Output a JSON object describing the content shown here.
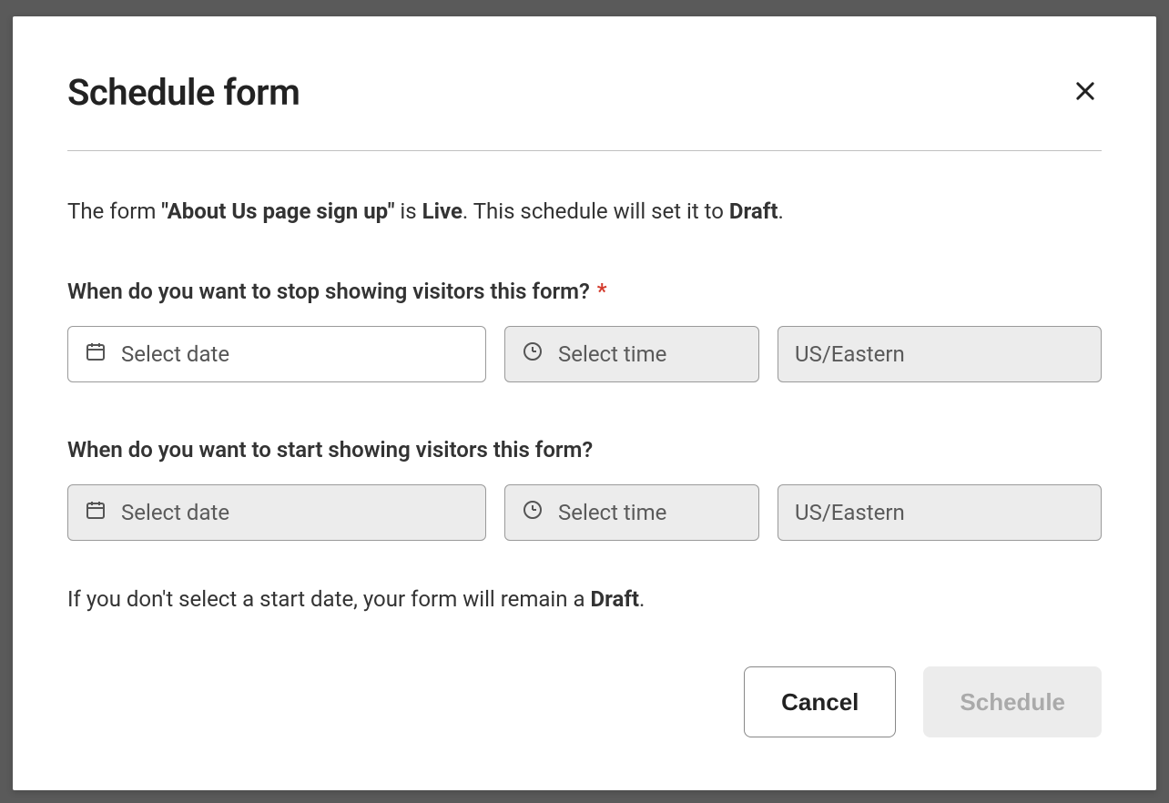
{
  "modal": {
    "title": "Schedule form",
    "status": {
      "prefix": "The form ",
      "formName": "\"About Us page sign up\"",
      "mid1": " is ",
      "state1": "Live",
      "mid2": ". This schedule will set it to ",
      "state2": "Draft",
      "suffix": "."
    },
    "stopSection": {
      "label": "When do you want to stop showing visitors this form?",
      "datePlaceholder": "Select date",
      "timePlaceholder": "Select time",
      "timezone": "US/Eastern"
    },
    "startSection": {
      "label": "When do you want to start showing visitors this form?",
      "datePlaceholder": "Select date",
      "timePlaceholder": "Select time",
      "timezone": "US/Eastern"
    },
    "note": {
      "prefix": "If you don't select a start date, your form will remain a ",
      "bold": "Draft",
      "suffix": "."
    },
    "buttons": {
      "cancel": "Cancel",
      "schedule": "Schedule"
    }
  }
}
